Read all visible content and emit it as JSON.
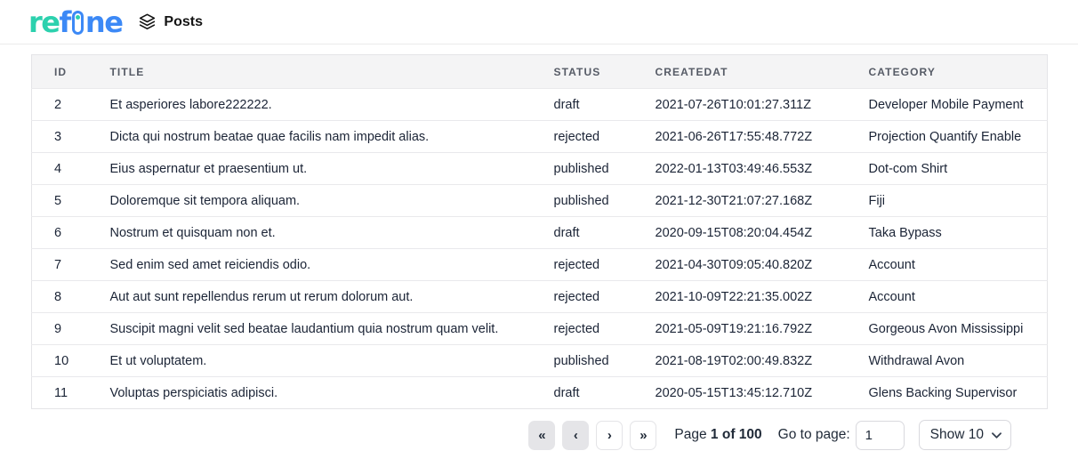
{
  "header": {
    "logo": {
      "part_re": "re",
      "part_f": "f",
      "part_ne": "ne"
    },
    "resource_title": "Posts"
  },
  "table": {
    "columns": [
      "ID",
      "TITLE",
      "STATUS",
      "CREATEDAT",
      "CATEGORY"
    ],
    "rows": [
      {
        "id": "2",
        "title": "Et asperiores labore222222.",
        "status": "draft",
        "createdAt": "2021-07-26T10:01:27.311Z",
        "category": "Developer Mobile Payment"
      },
      {
        "id": "3",
        "title": "Dicta qui nostrum beatae quae facilis nam impedit alias.",
        "status": "rejected",
        "createdAt": "2021-06-26T17:55:48.772Z",
        "category": "Projection Quantify Enable"
      },
      {
        "id": "4",
        "title": "Eius aspernatur et praesentium ut.",
        "status": "published",
        "createdAt": "2022-01-13T03:49:46.553Z",
        "category": "Dot-com Shirt"
      },
      {
        "id": "5",
        "title": "Doloremque sit tempora aliquam.",
        "status": "published",
        "createdAt": "2021-12-30T21:07:27.168Z",
        "category": "Fiji"
      },
      {
        "id": "6",
        "title": "Nostrum et quisquam non et.",
        "status": "draft",
        "createdAt": "2020-09-15T08:20:04.454Z",
        "category": "Taka Bypass"
      },
      {
        "id": "7",
        "title": "Sed enim sed amet reiciendis odio.",
        "status": "rejected",
        "createdAt": "2021-04-30T09:05:40.820Z",
        "category": "Account"
      },
      {
        "id": "8",
        "title": "Aut aut sunt repellendus rerum ut rerum dolorum aut.",
        "status": "rejected",
        "createdAt": "2021-10-09T22:21:35.002Z",
        "category": "Account"
      },
      {
        "id": "9",
        "title": "Suscipit magni velit sed beatae laudantium quia nostrum quam velit.",
        "status": "rejected",
        "createdAt": "2021-05-09T19:21:16.792Z",
        "category": "Gorgeous Avon Mississippi"
      },
      {
        "id": "10",
        "title": "Et ut voluptatem.",
        "status": "published",
        "createdAt": "2021-08-19T02:00:49.832Z",
        "category": "Withdrawal Avon"
      },
      {
        "id": "11",
        "title": "Voluptas perspiciatis adipisci.",
        "status": "draft",
        "createdAt": "2020-05-15T13:45:12.710Z",
        "category": "Glens Backing Supervisor"
      }
    ]
  },
  "pagination": {
    "first_label": "«",
    "prev_label": "‹",
    "next_label": "›",
    "last_label": "»",
    "page_label": "Page",
    "page_value": "1 of 100",
    "goto_label": "Go to page:",
    "goto_value": "1",
    "page_size_label": "Show 10"
  },
  "colors": {
    "logo_teal": "#2cd1ae",
    "logo_blue": "#3c89f6",
    "table_header_bg": "#f4f4f5",
    "border": "#e4e4e7",
    "text_dark": "#1b2436",
    "disabled_button_bg": "#e5e5e8"
  }
}
